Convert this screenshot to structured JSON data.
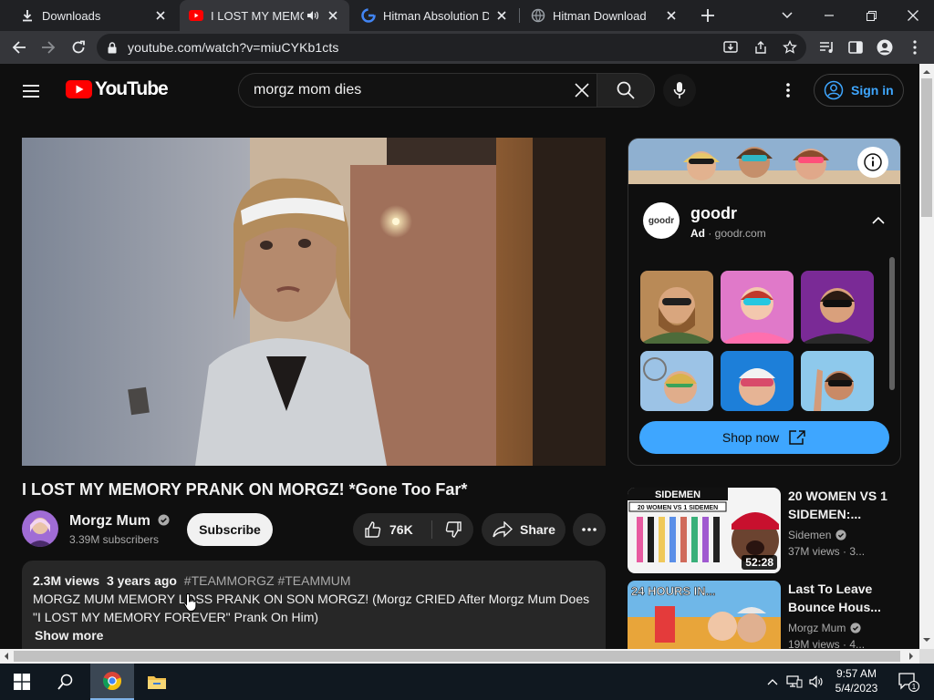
{
  "browser": {
    "tabs": [
      {
        "title": "Downloads",
        "icon": "download-icon",
        "active": false
      },
      {
        "title": "I LOST MY MEMOR",
        "icon": "youtube-icon",
        "active": true,
        "audio": true
      },
      {
        "title": "Hitman Absolution Do",
        "icon": "google-icon",
        "active": false
      },
      {
        "title": "Hitman Download",
        "icon": "globe-icon",
        "active": false
      }
    ],
    "url": "youtube.com/watch?v=miuCYKb1cts"
  },
  "youtube": {
    "logo_text": "YouTube",
    "search": {
      "query": "morgz mom dies"
    },
    "sign_in": "Sign in",
    "video": {
      "title": "I LOST MY MEMORY PRANK ON MORGZ! *Gone Too Far*",
      "channel": "Morgz Mum",
      "subscribers": "3.39M subscribers",
      "subscribe_label": "Subscribe",
      "likes": "76K",
      "share_label": "Share",
      "views": "2.3M views",
      "age": "3 years ago",
      "hashtags": "#TEAMMORGZ #TEAMMUM",
      "description": "MORGZ MUM MEMORY LOSS PRANK ON SON MORGZ! (Morgz CRIED After Morgz Mum Does \"I LOST MY MEMORY FOREVER\" Prank On Him)",
      "show_more": "Show more"
    },
    "ad": {
      "brand": "goodr",
      "logo_text": "goodr",
      "label": "Ad",
      "domain": "goodr.com",
      "cta": "Shop now"
    },
    "recommended": [
      {
        "title": "20 WOMEN VS 1 SIDEMEN:...",
        "channel": "Sidemen",
        "views": "37M views · 3...",
        "duration": "52:28",
        "thumb_text": "SIDEMEN",
        "thumb_sub": "20 WOMEN VS 1 SIDEMEN"
      },
      {
        "title": "Last To Leave Bounce Hous...",
        "channel": "Morgz Mum",
        "views": "19M views · 4...",
        "thumb_text": "24 HOURS IN..."
      }
    ]
  },
  "taskbar": {
    "time": "9:57 AM",
    "date": "5/4/2023",
    "notification_count": "1"
  }
}
